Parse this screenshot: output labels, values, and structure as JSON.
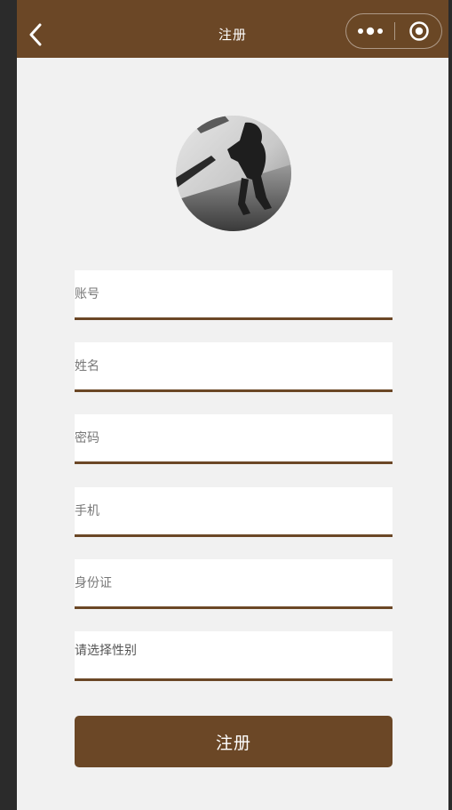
{
  "nav": {
    "title": "注册",
    "back_icon": "chevron-left-icon",
    "more_icon": "more-dots-icon",
    "close_icon": "target-close-icon",
    "background_color": "#6b4726"
  },
  "avatar": {
    "description_icon": "avatar-photo"
  },
  "form": {
    "fields": [
      {
        "placeholder": "账号"
      },
      {
        "placeholder": "姓名"
      },
      {
        "placeholder": "密码"
      },
      {
        "placeholder": "手机"
      },
      {
        "placeholder": "身份证"
      }
    ],
    "gender_select_label": "请选择性别",
    "submit_label": "注册",
    "accent_color": "#6b4726"
  }
}
